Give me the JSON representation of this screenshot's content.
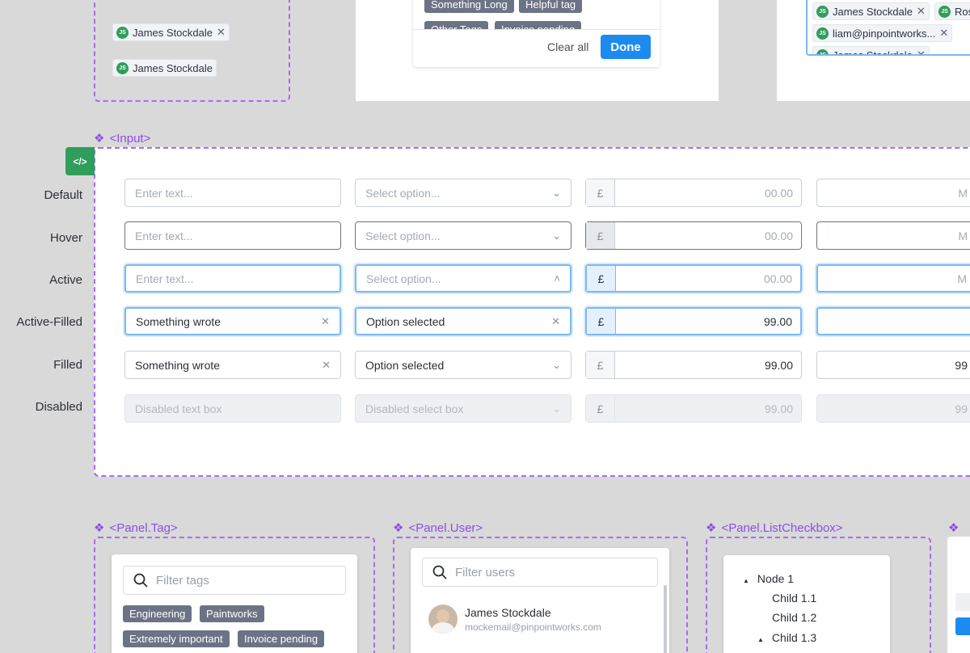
{
  "top": {
    "users": [
      "James Stockdale",
      "James Stockdale"
    ],
    "tags_partial": [
      "Something Long",
      "Helpful tag",
      "Other Tags",
      "Invoice pending"
    ],
    "clear_all": "Clear all",
    "done": "Done",
    "recipients": [
      "James Stockdale",
      "Ros",
      "liam@pinpointworks...",
      "James Stockdale"
    ],
    "avatar_initials": "JS"
  },
  "input_section": {
    "title": "<Input>",
    "code_icon": "</>",
    "rows": [
      {
        "label": "Default",
        "text": "Enter text...",
        "select": "Select option...",
        "currency": "£",
        "amount": "00.00",
        "extra": "M"
      },
      {
        "label": "Hover",
        "text": "Enter text...",
        "select": "Select option...",
        "currency": "£",
        "amount": "00.00",
        "extra": "M"
      },
      {
        "label": "Active",
        "text": "Enter text...",
        "select": "Select option...",
        "currency": "£",
        "amount": "00.00",
        "extra": "M"
      },
      {
        "label": "Active-Filled",
        "text": "Something wrote",
        "select": "Option selected",
        "currency": "£",
        "amount": "99.00",
        "extra": ""
      },
      {
        "label": "Filled",
        "text": "Something wrote",
        "select": "Option selected",
        "currency": "£",
        "amount": "99.00",
        "extra": "99"
      },
      {
        "label": "Disabled",
        "text": "Disabled text box",
        "select": "Disabled select box",
        "currency": "£",
        "amount": "99.00",
        "extra": "99"
      }
    ]
  },
  "panel_tag": {
    "title": "<Panel.Tag>",
    "placeholder": "Filter tags",
    "tags": [
      "Engineering",
      "Paintworks",
      "Extremely important",
      "Invoice pending"
    ]
  },
  "panel_user": {
    "title": "<Panel.User>",
    "placeholder": "Filter users",
    "user_name": "James Stockdale",
    "user_email": "mockemail@pinpointworks.com"
  },
  "panel_list": {
    "title": "<Panel.ListCheckbox>",
    "nodes": [
      "Node 1",
      "Child 1.1",
      "Child 1.2",
      "Child 1.3"
    ]
  },
  "colors": {
    "accent": "#1b8bf0",
    "frame": "#a56cf0",
    "tag": "#6b7384"
  }
}
